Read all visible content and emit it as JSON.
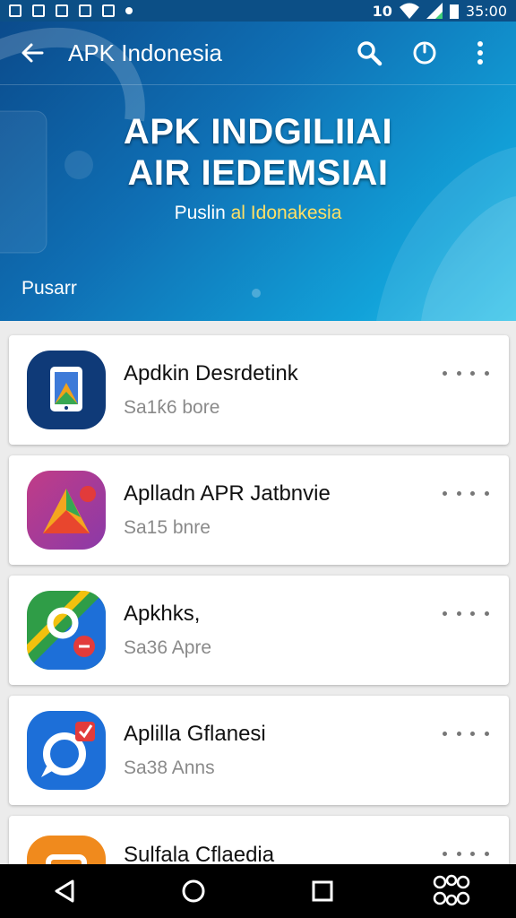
{
  "status_bar": {
    "left_icons": [
      "notification-icon",
      "shield-icon",
      "app-icon",
      "app-icon",
      "app-icon",
      "dropdown-icon"
    ],
    "right_number": "10",
    "time": "35:00"
  },
  "toolbar": {
    "title": "APK Indonesia",
    "back_icon": "arrow-left-icon",
    "search_icon": "search-icon",
    "power_icon": "power-icon",
    "menu_icon": "more-vert-icon"
  },
  "hero": {
    "line1": "APK INDGILIIAI",
    "line2": "AIR IEDEMSIAI",
    "subtitle_prefix": "Puslin ",
    "subtitle_accent": "al Idonakesia",
    "label": "Pusarr"
  },
  "apps": [
    {
      "name": "Apdkin Desrdetink",
      "size": "Sa1ƙ6 bore",
      "icon": "tablet-app-icon",
      "colors": [
        "#0f3a78",
        "#ffffff"
      ]
    },
    {
      "name": "Aplladn APR Jatbnvie",
      "size": "Sa15 bnre",
      "icon": "play-triangle-app-icon",
      "colors": [
        "#c13c87",
        "#f4a51f"
      ]
    },
    {
      "name": "Apkhks,",
      "size": "Sa36 Apre",
      "icon": "maps-pin-app-icon",
      "colors": [
        "#2f9d47",
        "#f3c10e"
      ]
    },
    {
      "name": "Aplilla Gflanesi",
      "size": "Sa38 Anns",
      "icon": "chat-bubble-app-icon",
      "colors": [
        "#1d6fd8",
        "#e23b3b"
      ]
    },
    {
      "name": "Sulfala Cflaedia",
      "size": "",
      "icon": "orange-app-icon",
      "colors": [
        "#f08a1d",
        "#ffffff"
      ]
    }
  ],
  "nav": {
    "back_icon": "nav-back-icon",
    "home_icon": "nav-home-icon",
    "recents_icon": "nav-recents-icon",
    "extra_icon": "nav-accessibility-icon"
  }
}
